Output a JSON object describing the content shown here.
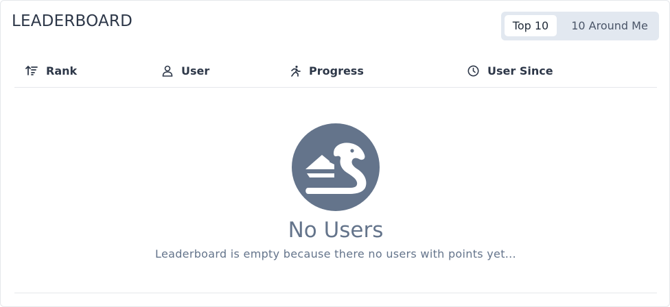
{
  "header": {
    "title": "LEADERBOARD",
    "toggle": {
      "options": [
        "Top 10",
        "10 Around Me"
      ],
      "selected": "Top 10"
    }
  },
  "table": {
    "columns": [
      {
        "label": "Rank",
        "icon": "sort-ascending-icon"
      },
      {
        "label": "User",
        "icon": "user-icon"
      },
      {
        "label": "Progress",
        "icon": "running-person-icon"
      },
      {
        "label": "User Since",
        "icon": "clock-icon"
      }
    ]
  },
  "empty_state": {
    "icon": "dragon-icon",
    "title": "No Users",
    "description": "Leaderboard is empty because there no users with points yet..."
  },
  "colors": {
    "accent": "#64748b",
    "toggle_bg": "#e2e8f0",
    "text": "#2d3748"
  }
}
